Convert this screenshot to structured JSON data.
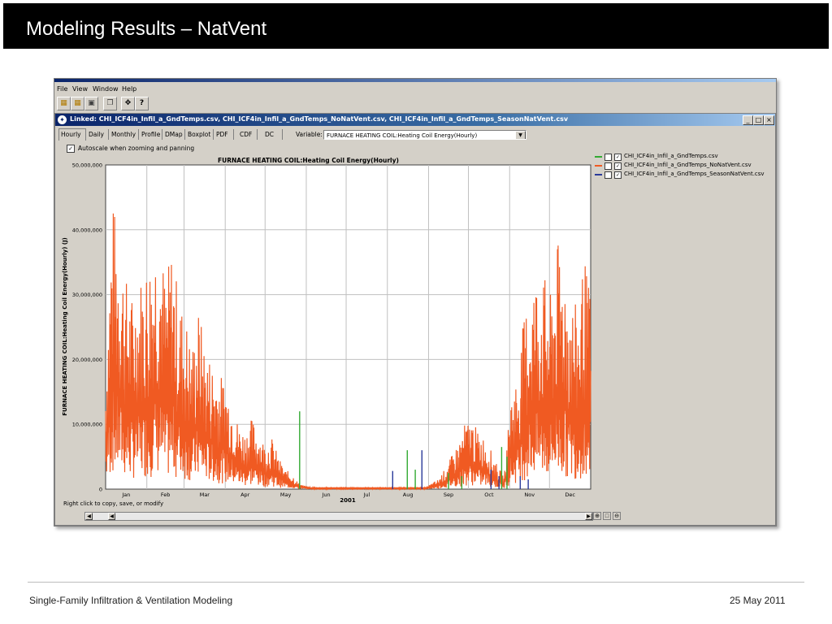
{
  "slide": {
    "title": "Modeling Results – NatVent",
    "footer_left": "Single-Family Infiltration & Ventilation Modeling",
    "footer_right": "25 May 2011"
  },
  "app": {
    "menu": [
      "File",
      "View",
      "Window",
      "Help"
    ],
    "toolbar_icons": [
      "open-folder-icon",
      "open-folder-2-icon",
      "save-disk-icon",
      "copy-icon",
      "move-icon",
      "help-icon"
    ],
    "inner_title": "Linked: CHI_ICF4in_Infil_a_GndTemps.csv, CHI_ICF4in_Infil_a_GndTemps_NoNatVent.csv, CHI_ICF4in_Infil_a_GndTemps_SeasonNatVent.csv",
    "window_buttons": [
      "_",
      "□",
      "×"
    ],
    "tabs": [
      "Hourly",
      "Daily",
      "Monthly",
      "Profile",
      "DMap",
      "Boxplot",
      "PDF",
      "CDF",
      "DC"
    ],
    "variable_label": "Variable:",
    "variable_value": "FURNACE HEATING COIL:Heating Coil Energy(Hourly)",
    "autoscale_label": "Autoscale when zooming and panning",
    "status_text": "Right click to copy, save, or modify"
  },
  "chart_data": {
    "type": "line",
    "title": "FURNACE HEATING COIL:Heating Coil Energy(Hourly)",
    "xlabel": "2001",
    "ylabel": "FURNACE HEATING COIL:Heating Coil Energy(Hourly) (J)",
    "x_tick_labels": [
      "Jan",
      "Feb",
      "Mar",
      "Apr",
      "May",
      "Jun",
      "Jul",
      "Aug",
      "Sep",
      "Oct",
      "Nov",
      "Dec"
    ],
    "y_tick_labels": [
      "0",
      "10,000,000",
      "20,000,000",
      "30,000,000",
      "40,000,000",
      "50,000,000"
    ],
    "ylim": [
      0,
      50000000
    ],
    "xlim_days": [
      0,
      365
    ],
    "grid": true,
    "legend_position": "right",
    "series": [
      {
        "name": "CHI_ICF4in_Infil_a_GndTemps.csv",
        "color": "#33aa33",
        "checked": true
      },
      {
        "name": "CHI_ICF4in_Infil_a_GndTemps_NoNatVent.csv",
        "color": "#f05a22",
        "checked": true
      },
      {
        "name": "CHI_ICF4in_Infil_a_GndTemps_SeasonNatVent.csv",
        "color": "#2a3a9a",
        "checked": true
      }
    ],
    "envelope_points": [
      [
        0,
        18000000
      ],
      [
        5,
        45000000
      ],
      [
        10,
        40000000
      ],
      [
        15,
        33000000
      ],
      [
        20,
        30000000
      ],
      [
        30,
        35000000
      ],
      [
        35,
        38000000
      ],
      [
        40,
        42000000
      ],
      [
        45,
        32000000
      ],
      [
        50,
        38000000
      ],
      [
        55,
        30000000
      ],
      [
        60,
        27000000
      ],
      [
        65,
        22000000
      ],
      [
        70,
        28000000
      ],
      [
        75,
        22000000
      ],
      [
        80,
        20000000
      ],
      [
        85,
        18000000
      ],
      [
        90,
        17000000
      ],
      [
        95,
        14000000
      ],
      [
        100,
        10000000
      ],
      [
        105,
        9000000
      ],
      [
        110,
        11000000
      ],
      [
        115,
        9000000
      ],
      [
        120,
        7000000
      ],
      [
        125,
        8000000
      ],
      [
        130,
        5000000
      ],
      [
        135,
        3000000
      ],
      [
        140,
        2500000
      ],
      [
        145,
        1000000
      ],
      [
        150,
        500000
      ],
      [
        155,
        300000
      ],
      [
        160,
        200000
      ],
      [
        240,
        200000
      ],
      [
        250,
        1500000
      ],
      [
        255,
        3000000
      ],
      [
        260,
        5000000
      ],
      [
        265,
        7000000
      ],
      [
        270,
        10000000
      ],
      [
        275,
        11000000
      ],
      [
        280,
        9000000
      ],
      [
        285,
        8000000
      ],
      [
        290,
        6000000
      ],
      [
        295,
        3500000
      ],
      [
        300,
        2000000
      ],
      [
        305,
        15000000
      ],
      [
        310,
        18000000
      ],
      [
        315,
        27000000
      ],
      [
        320,
        32000000
      ],
      [
        325,
        34000000
      ],
      [
        330,
        33000000
      ],
      [
        335,
        30000000
      ],
      [
        340,
        38000000
      ],
      [
        345,
        36000000
      ],
      [
        350,
        30000000
      ],
      [
        355,
        28000000
      ],
      [
        360,
        36000000
      ],
      [
        365,
        30000000
      ]
    ],
    "spikes_gndtemps": [
      [
        146,
        12000000
      ],
      [
        227,
        6000000
      ],
      [
        233,
        3000000
      ],
      [
        258,
        2500000
      ],
      [
        268,
        2000000
      ],
      [
        302,
        5000000
      ],
      [
        298,
        6500000
      ]
    ],
    "spikes_seasonnatvent": [
      [
        216,
        2800000
      ],
      [
        238,
        6000000
      ],
      [
        290,
        3000000
      ],
      [
        312,
        2000000
      ],
      [
        318,
        1500000
      ],
      [
        296,
        2000000
      ]
    ]
  }
}
